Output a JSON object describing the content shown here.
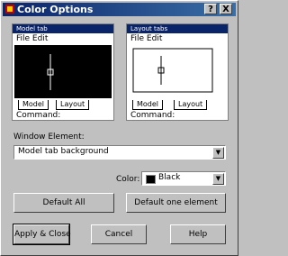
{
  "window": {
    "title": "Color Options",
    "help_btn": "?",
    "close_btn": "X"
  },
  "preview_model": {
    "title": "Model tab",
    "menu": "File Edit",
    "tab1": "Model",
    "tab2": "Layout",
    "command": "Command:",
    "bg": "#000000",
    "fg": "#ffffff"
  },
  "preview_layout": {
    "title": "Layout tabs",
    "menu": "File Edit",
    "tab1": "Model",
    "tab2": "Layout",
    "command": "Command:",
    "bg": "#ffffff",
    "fg": "#000000"
  },
  "window_element": {
    "label": "Window Element:",
    "value": "Model tab background"
  },
  "color": {
    "label": "Color:",
    "value": "Black",
    "swatch": "#000000"
  },
  "buttons": {
    "default_all": "Default All",
    "default_one": "Default one element",
    "apply_close": "Apply & Close",
    "cancel": "Cancel",
    "help": "Help"
  }
}
